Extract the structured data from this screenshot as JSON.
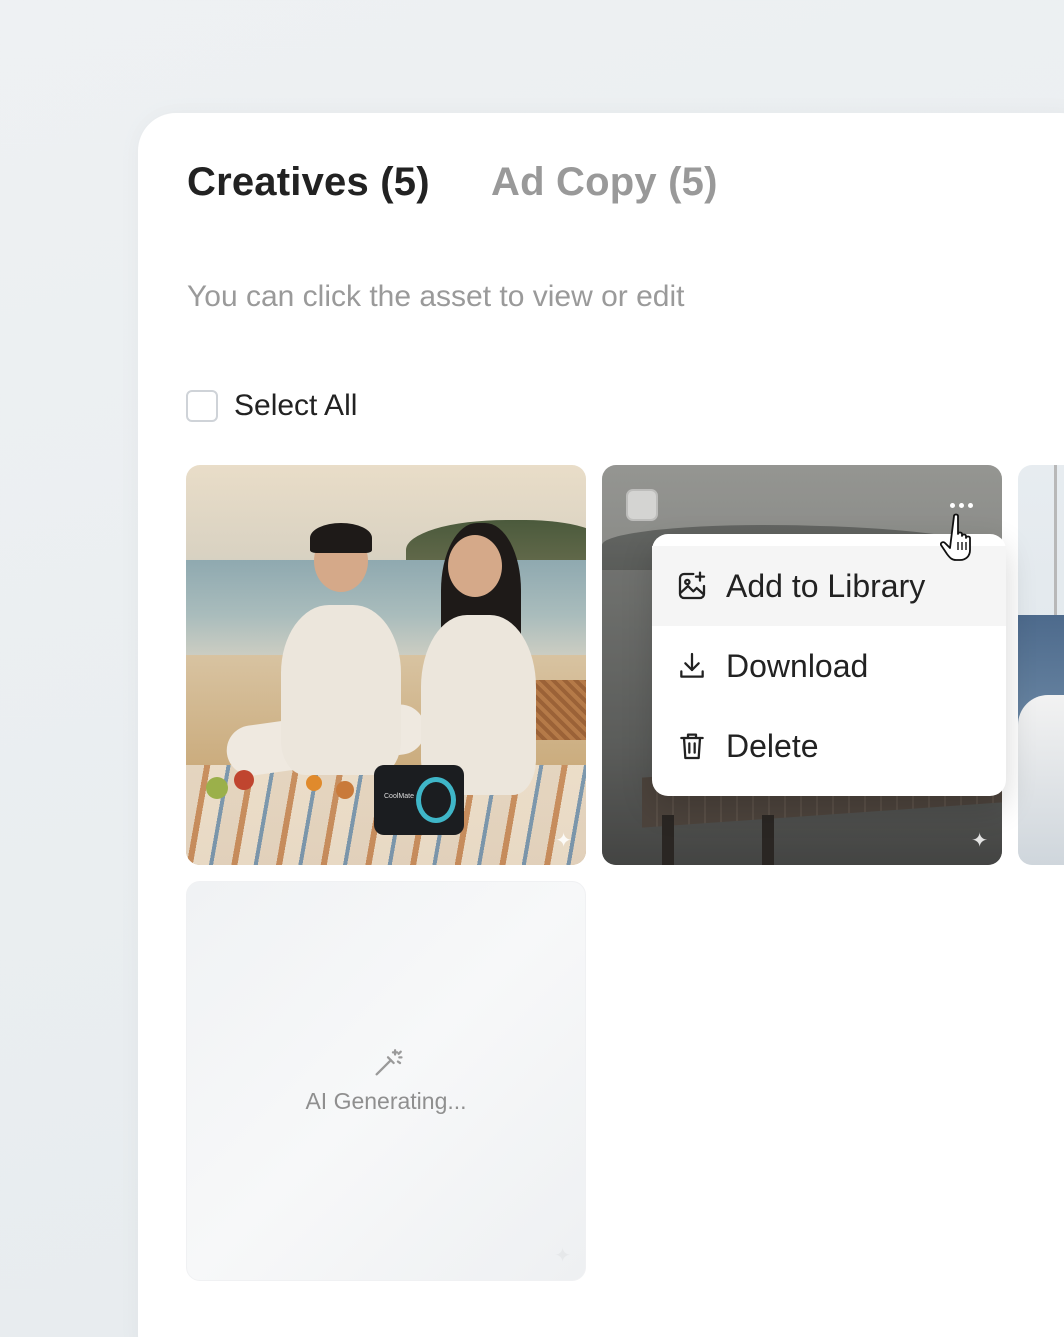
{
  "tabs": [
    {
      "label": "Creatives (5)",
      "active": true
    },
    {
      "label": "Ad Copy (5)",
      "active": false
    }
  ],
  "hint": "You can click the asset to view or edit",
  "select_all": {
    "label": "Select All",
    "checked": false
  },
  "cards": [
    {
      "type": "image",
      "scene": "beach picnic",
      "speaker_brand": "CoolMate"
    },
    {
      "type": "image",
      "scene": "lake dock",
      "menu_open": true
    },
    {
      "type": "image",
      "scene": "sailboat",
      "partially_visible": true
    },
    {
      "type": "generating",
      "label": "AI Generating...",
      "icon": "magic-wand-icon"
    }
  ],
  "context_menu": {
    "items": [
      {
        "label": "Add to Library",
        "icon": "add-image-icon"
      },
      {
        "label": "Download",
        "icon": "download-icon"
      },
      {
        "label": "Delete",
        "icon": "trash-icon"
      }
    ]
  },
  "colors": {
    "accent_ring": "#3fb6c8",
    "text_primary": "#222222",
    "text_muted": "#999999"
  }
}
